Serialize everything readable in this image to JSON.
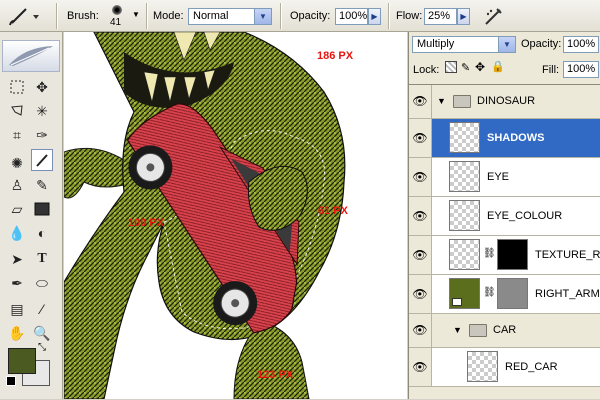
{
  "options_bar": {
    "brush_label": "Brush:",
    "brush_size": "41",
    "mode_label": "Mode:",
    "mode_value": "Normal",
    "opacity_label": "Opacity:",
    "opacity_value": "100%",
    "flow_label": "Flow:",
    "flow_value": "25%"
  },
  "canvas": {
    "measure_top": "186 PX",
    "measure_left": "100 PX",
    "measure_mid": "61 PX",
    "measure_bottom": "123 PX"
  },
  "colors": {
    "foreground": "#4a5a20",
    "background": "#e8e8e8",
    "measure": "#e8150f",
    "selected_layer": "#316ac5"
  },
  "layers_panel": {
    "blend_mode": "Multiply",
    "opacity_label": "Opacity:",
    "opacity_value": "100%",
    "lock_label": "Lock:",
    "fill_label": "Fill:",
    "fill_value": "100%",
    "layers": [
      {
        "name": "DINOSAUR",
        "type": "group"
      },
      {
        "name": "SHADOWS",
        "type": "layer",
        "selected": true
      },
      {
        "name": "EYE",
        "type": "layer"
      },
      {
        "name": "EYE_COLOUR",
        "type": "layer"
      },
      {
        "name": "TEXTURE_RAP",
        "type": "masked"
      },
      {
        "name": "RIGHT_ARM",
        "type": "masked"
      },
      {
        "name": "CAR",
        "type": "group"
      },
      {
        "name": "RED_CAR",
        "type": "layer"
      }
    ]
  }
}
